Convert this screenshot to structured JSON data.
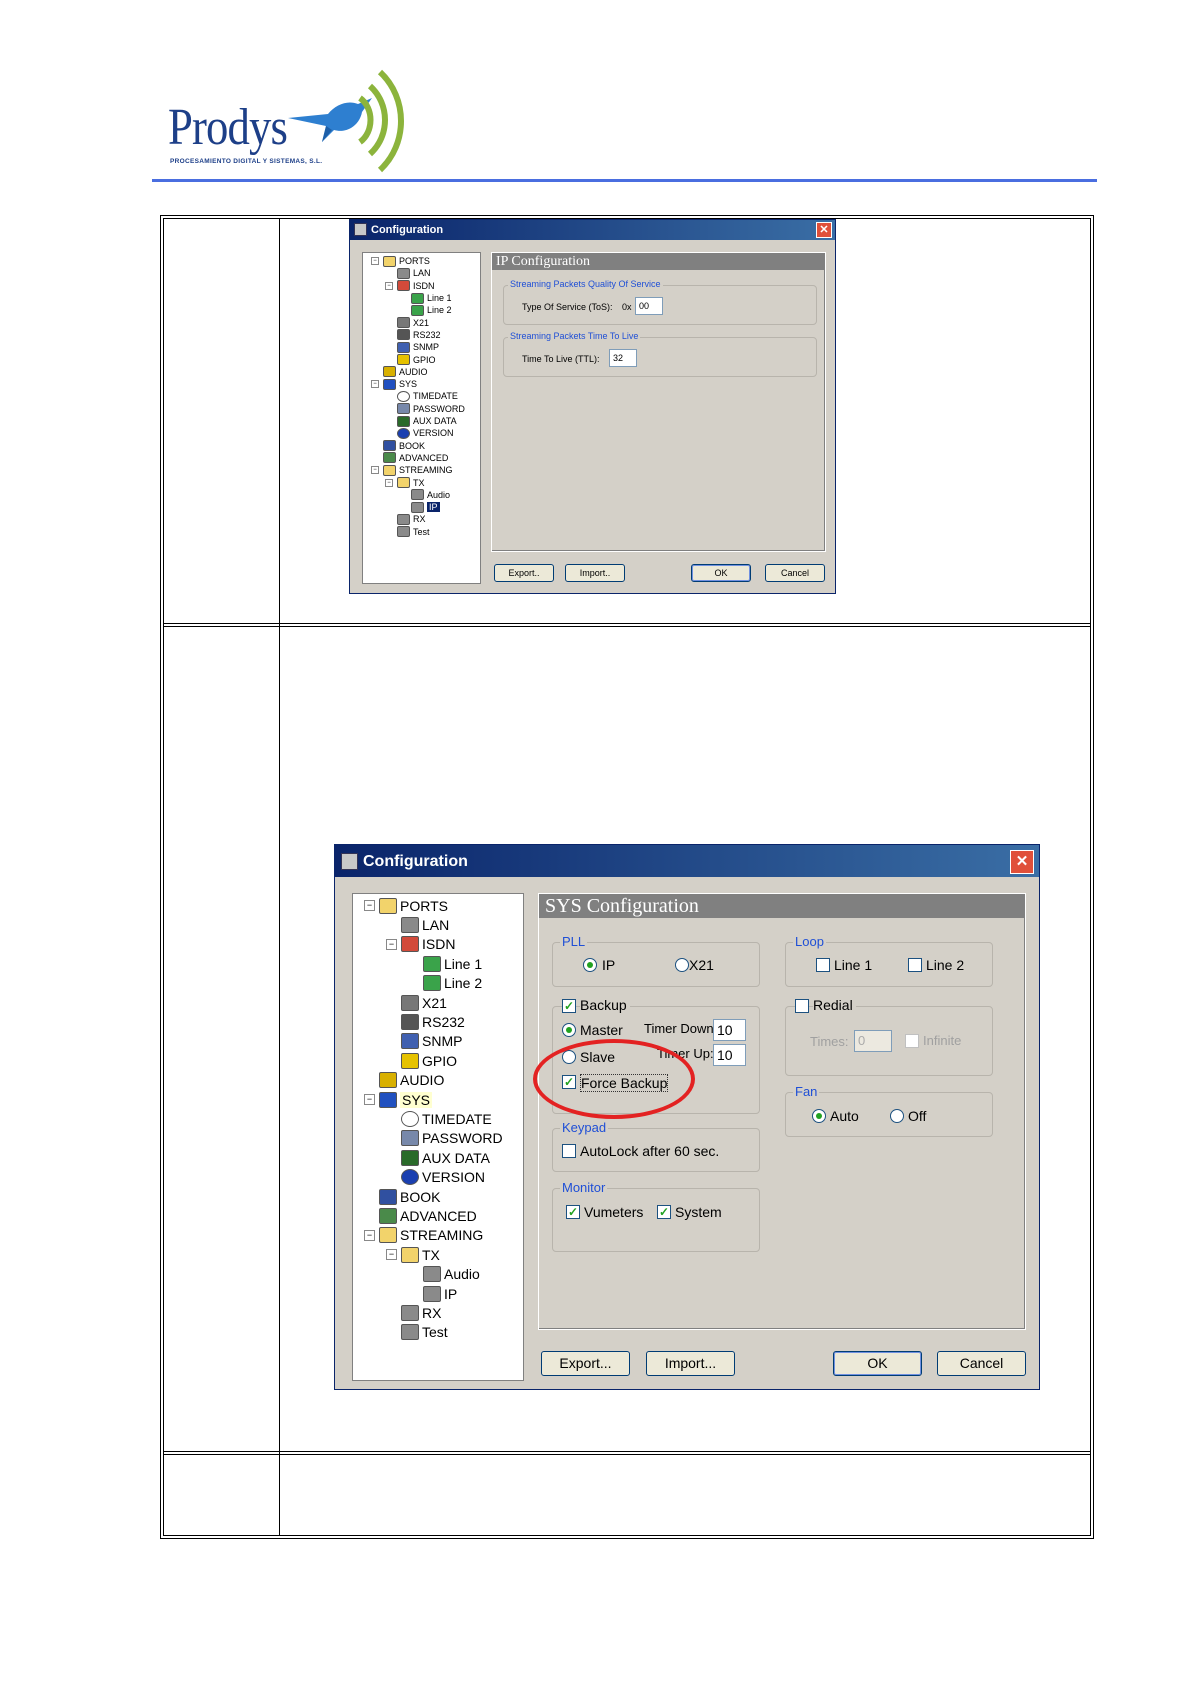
{
  "header": {
    "brand": "Prodys",
    "tagline": "PROCESAMIENTO DIGITAL Y SISTEMAS, S.L."
  },
  "colors": {
    "brand_blue": "#1d3f88",
    "bird_blue": "#2e7fd0",
    "waves_green": "#8cb43c",
    "rule_blue": "#4a6ee0",
    "highlight_red": "#e32222"
  },
  "dialog1": {
    "title": "Configuration",
    "panel_title": "IP Configuration",
    "tree": [
      "PORTS",
      "LAN",
      "ISDN",
      "Line 1",
      "Line 2",
      "X21",
      "RS232",
      "SNMP",
      "GPIO",
      "AUDIO",
      "SYS",
      "TIMEDATE",
      "PASSWORD",
      "AUX DATA",
      "VERSION",
      "BOOK",
      "ADVANCED",
      "STREAMING",
      "TX",
      "Audio",
      "IP",
      "RX",
      "Test"
    ],
    "qos_group": "Streaming Packets Quality Of Service",
    "tos_label": "Type Of Service (ToS):",
    "tos_prefix": "0x",
    "tos_value": "00",
    "ttl_group": "Streaming Packets Time To Live",
    "ttl_label": "Time To Live (TTL):",
    "ttl_value": "32",
    "buttons": {
      "export": "Export..",
      "import": "Import..",
      "ok": "OK",
      "cancel": "Cancel"
    }
  },
  "dialog2": {
    "title": "Configuration",
    "panel_title": "SYS Configuration",
    "tree": [
      "PORTS",
      "LAN",
      "ISDN",
      "Line 1",
      "Line 2",
      "X21",
      "RS232",
      "SNMP",
      "GPIO",
      "AUDIO",
      "SYS",
      "TIMEDATE",
      "PASSWORD",
      "AUX DATA",
      "VERSION",
      "BOOK",
      "ADVANCED",
      "STREAMING",
      "TX",
      "Audio",
      "IP",
      "RX",
      "Test"
    ],
    "pll": {
      "legend": "PLL",
      "ip": "IP",
      "x21": "X21"
    },
    "backup": {
      "label": "Backup",
      "master": "Master",
      "slave": "Slave",
      "timer_down_label": "Timer Down:",
      "timer_down": "10",
      "timer_up_label": "Timer Up:",
      "timer_up": "10",
      "force": "Force Backup"
    },
    "keypad": {
      "legend": "Keypad",
      "autolock": "AutoLock after 60 sec."
    },
    "monitor": {
      "legend": "Monitor",
      "vumeters": "Vumeters",
      "system": "System"
    },
    "loop": {
      "legend": "Loop",
      "line1": "Line 1",
      "line2": "Line 2"
    },
    "redial": {
      "label": "Redial",
      "times_label": "Times:",
      "times_value": "0",
      "infinite": "Infinite"
    },
    "fan": {
      "legend": "Fan",
      "auto": "Auto",
      "off": "Off"
    },
    "buttons": {
      "export": "Export...",
      "import": "Import...",
      "ok": "OK",
      "cancel": "Cancel"
    }
  }
}
